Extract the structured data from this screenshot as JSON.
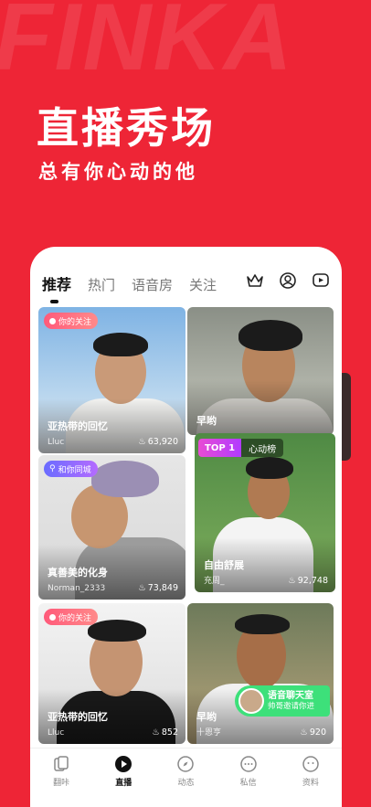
{
  "brand_watermark": "FINKA",
  "hero": {
    "title": "直播秀场",
    "subtitle": "总有你心动的他"
  },
  "tabs": [
    {
      "label": "推荐",
      "active": true
    },
    {
      "label": "热门",
      "active": false
    },
    {
      "label": "语音房",
      "active": false
    },
    {
      "label": "关注",
      "active": false
    }
  ],
  "top_icons": [
    "crown-icon",
    "profile-circle-icon",
    "play-chat-icon"
  ],
  "cards": [
    {
      "badge": "你的关注",
      "title": "亚热带的回忆",
      "user": "Lluc",
      "count": "63,920"
    },
    {
      "title": "早哟"
    },
    {
      "top_tag": "TOP 1",
      "top_label": "心动榜",
      "title": "自由舒展",
      "user": "充周_",
      "count": "92,748"
    },
    {
      "badge": "和你同城",
      "title": "真善美的化身",
      "user": "Norman_2333",
      "count": "73,849"
    },
    {
      "badge": "你的关注",
      "title": "亚热带的回忆",
      "user": "Lluc",
      "count": "852"
    },
    {
      "title": "早哟",
      "user": "十恩亨",
      "count": "920",
      "voice_title": "语音聊天室",
      "voice_sub": "帅哥邀请你进"
    }
  ],
  "bottom_nav": [
    {
      "label": "翻咔",
      "icon": "cards-icon",
      "active": false
    },
    {
      "label": "直播",
      "icon": "live-play-icon",
      "active": true
    },
    {
      "label": "动态",
      "icon": "compass-icon",
      "active": false
    },
    {
      "label": "私信",
      "icon": "chat-bubble-icon",
      "active": false
    },
    {
      "label": "资料",
      "icon": "face-icon",
      "active": false
    }
  ],
  "colors": {
    "brand_red": "#ee2536",
    "voice_green": "#3de07a",
    "top_purple": "#b13bff"
  }
}
